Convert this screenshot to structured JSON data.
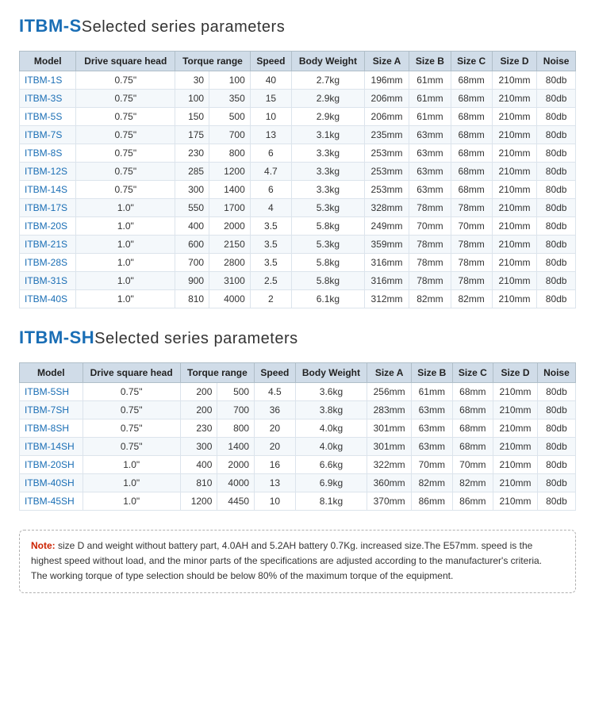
{
  "sections": [
    {
      "id": "itbm-s",
      "title_bold": "ITBM-S",
      "title_normal": "Selected series parameters",
      "columns": [
        "Model",
        "Drive square head",
        "Torque range",
        "",
        "Speed",
        "Body Weight",
        "Size A",
        "Size B",
        "Size C",
        "Size D",
        "Noise"
      ],
      "col_keys": [
        "model",
        "drive",
        "torq1",
        "torq2",
        "speed",
        "weight",
        "sizeA",
        "sizeB",
        "sizeC",
        "sizeD",
        "noise"
      ],
      "rows": [
        {
          "model": "ITBM-1S",
          "drive": "0.75\"",
          "torq1": "30",
          "torq2": "100",
          "speed": "40",
          "weight": "2.7kg",
          "sizeA": "196mm",
          "sizeB": "61mm",
          "sizeC": "68mm",
          "sizeD": "210mm",
          "noise": "80db"
        },
        {
          "model": "ITBM-3S",
          "drive": "0.75\"",
          "torq1": "100",
          "torq2": "350",
          "speed": "15",
          "weight": "2.9kg",
          "sizeA": "206mm",
          "sizeB": "61mm",
          "sizeC": "68mm",
          "sizeD": "210mm",
          "noise": "80db"
        },
        {
          "model": "ITBM-5S",
          "drive": "0.75\"",
          "torq1": "150",
          "torq2": "500",
          "speed": "10",
          "weight": "2.9kg",
          "sizeA": "206mm",
          "sizeB": "61mm",
          "sizeC": "68mm",
          "sizeD": "210mm",
          "noise": "80db"
        },
        {
          "model": "ITBM-7S",
          "drive": "0.75\"",
          "torq1": "175",
          "torq2": "700",
          "speed": "13",
          "weight": "3.1kg",
          "sizeA": "235mm",
          "sizeB": "63mm",
          "sizeC": "68mm",
          "sizeD": "210mm",
          "noise": "80db"
        },
        {
          "model": "ITBM-8S",
          "drive": "0.75\"",
          "torq1": "230",
          "torq2": "800",
          "speed": "6",
          "weight": "3.3kg",
          "sizeA": "253mm",
          "sizeB": "63mm",
          "sizeC": "68mm",
          "sizeD": "210mm",
          "noise": "80db"
        },
        {
          "model": "ITBM-12S",
          "drive": "0.75\"",
          "torq1": "285",
          "torq2": "1200",
          "speed": "4.7",
          "weight": "3.3kg",
          "sizeA": "253mm",
          "sizeB": "63mm",
          "sizeC": "68mm",
          "sizeD": "210mm",
          "noise": "80db"
        },
        {
          "model": "ITBM-14S",
          "drive": "0.75\"",
          "torq1": "300",
          "torq2": "1400",
          "speed": "6",
          "weight": "3.3kg",
          "sizeA": "253mm",
          "sizeB": "63mm",
          "sizeC": "68mm",
          "sizeD": "210mm",
          "noise": "80db"
        },
        {
          "model": "ITBM-17S",
          "drive": "1.0\"",
          "torq1": "550",
          "torq2": "1700",
          "speed": "4",
          "weight": "5.3kg",
          "sizeA": "328mm",
          "sizeB": "78mm",
          "sizeC": "78mm",
          "sizeD": "210mm",
          "noise": "80db"
        },
        {
          "model": "ITBM-20S",
          "drive": "1.0\"",
          "torq1": "400",
          "torq2": "2000",
          "speed": "3.5",
          "weight": "5.8kg",
          "sizeA": "249mm",
          "sizeB": "70mm",
          "sizeC": "70mm",
          "sizeD": "210mm",
          "noise": "80db"
        },
        {
          "model": "ITBM-21S",
          "drive": "1.0\"",
          "torq1": "600",
          "torq2": "2150",
          "speed": "3.5",
          "weight": "5.3kg",
          "sizeA": "359mm",
          "sizeB": "78mm",
          "sizeC": "78mm",
          "sizeD": "210mm",
          "noise": "80db"
        },
        {
          "model": "ITBM-28S",
          "drive": "1.0\"",
          "torq1": "700",
          "torq2": "2800",
          "speed": "3.5",
          "weight": "5.8kg",
          "sizeA": "316mm",
          "sizeB": "78mm",
          "sizeC": "78mm",
          "sizeD": "210mm",
          "noise": "80db"
        },
        {
          "model": "ITBM-31S",
          "drive": "1.0\"",
          "torq1": "900",
          "torq2": "3100",
          "speed": "2.5",
          "weight": "5.8kg",
          "sizeA": "316mm",
          "sizeB": "78mm",
          "sizeC": "78mm",
          "sizeD": "210mm",
          "noise": "80db"
        },
        {
          "model": "ITBM-40S",
          "drive": "1.0\"",
          "torq1": "810",
          "torq2": "4000",
          "speed": "2",
          "weight": "6.1kg",
          "sizeA": "312mm",
          "sizeB": "82mm",
          "sizeC": "82mm",
          "sizeD": "210mm",
          "noise": "80db"
        }
      ]
    },
    {
      "id": "itbm-sh",
      "title_bold": "ITBM-SH",
      "title_normal": "Selected series parameters",
      "columns": [
        "Model",
        "Drive square head",
        "Torque range",
        "",
        "Speed",
        "Body Weight",
        "Size A",
        "Size B",
        "Size C",
        "Size D",
        "Noise"
      ],
      "col_keys": [
        "model",
        "drive",
        "torq1",
        "torq2",
        "speed",
        "weight",
        "sizeA",
        "sizeB",
        "sizeC",
        "sizeD",
        "noise"
      ],
      "rows": [
        {
          "model": "ITBM-5SH",
          "drive": "0.75\"",
          "torq1": "200",
          "torq2": "500",
          "speed": "4.5",
          "weight": "3.6kg",
          "sizeA": "256mm",
          "sizeB": "61mm",
          "sizeC": "68mm",
          "sizeD": "210mm",
          "noise": "80db"
        },
        {
          "model": "ITBM-7SH",
          "drive": "0.75\"",
          "torq1": "200",
          "torq2": "700",
          "speed": "36",
          "weight": "3.8kg",
          "sizeA": "283mm",
          "sizeB": "63mm",
          "sizeC": "68mm",
          "sizeD": "210mm",
          "noise": "80db"
        },
        {
          "model": "ITBM-8SH",
          "drive": "0.75\"",
          "torq1": "230",
          "torq2": "800",
          "speed": "20",
          "weight": "4.0kg",
          "sizeA": "301mm",
          "sizeB": "63mm",
          "sizeC": "68mm",
          "sizeD": "210mm",
          "noise": "80db"
        },
        {
          "model": "ITBM-14SH",
          "drive": "0.75\"",
          "torq1": "300",
          "torq2": "1400",
          "speed": "20",
          "weight": "4.0kg",
          "sizeA": "301mm",
          "sizeB": "63mm",
          "sizeC": "68mm",
          "sizeD": "210mm",
          "noise": "80db"
        },
        {
          "model": "ITBM-20SH",
          "drive": "1.0\"",
          "torq1": "400",
          "torq2": "2000",
          "speed": "16",
          "weight": "6.6kg",
          "sizeA": "322mm",
          "sizeB": "70mm",
          "sizeC": "70mm",
          "sizeD": "210mm",
          "noise": "80db"
        },
        {
          "model": "ITBM-40SH",
          "drive": "1.0\"",
          "torq1": "810",
          "torq2": "4000",
          "speed": "13",
          "weight": "6.9kg",
          "sizeA": "360mm",
          "sizeB": "82mm",
          "sizeC": "82mm",
          "sizeD": "210mm",
          "noise": "80db"
        },
        {
          "model": "ITBM-45SH",
          "drive": "1.0\"",
          "torq1": "1200",
          "torq2": "4450",
          "speed": "10",
          "weight": "8.1kg",
          "sizeA": "370mm",
          "sizeB": "86mm",
          "sizeC": "86mm",
          "sizeD": "210mm",
          "noise": "80db"
        }
      ]
    }
  ],
  "note": {
    "label": "Note:",
    "text": " size D and weight without battery part, 4.0AH and 5.2AH battery 0.7Kg. increased size.The E57mm. speed is the highest speed without load, and the minor parts of the specifications are adjusted according to the manufacturer's criteria.",
    "text2": "The working torque of type selection should be below 80% of the maximum torque of the equipment."
  },
  "torque_header": "Torque range"
}
